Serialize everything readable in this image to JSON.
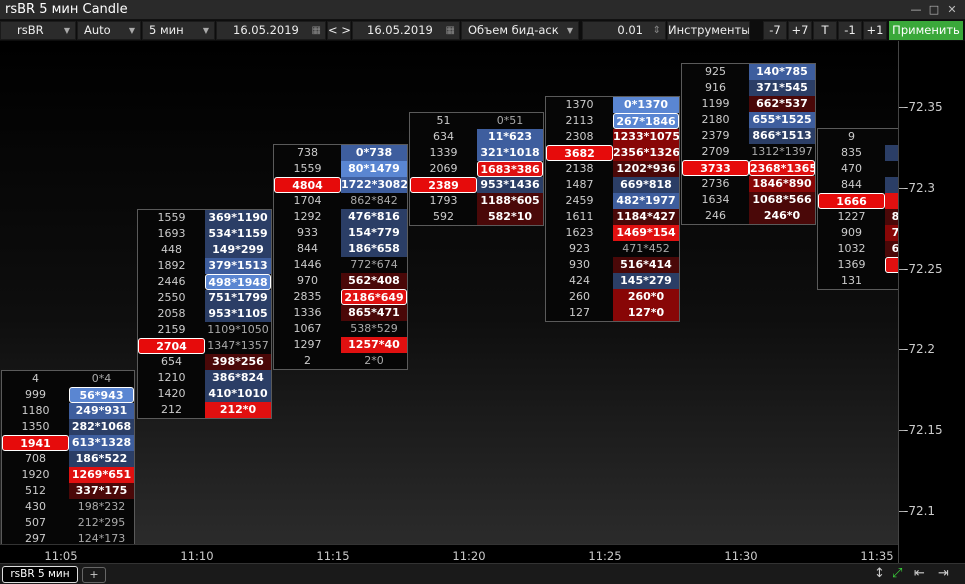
{
  "window": {
    "title": "rsBR 5 мин Candle"
  },
  "toolbar": {
    "symbol": "rsBR",
    "scale": "Auto",
    "timeframe": "5 мин",
    "date_from": "16.05.2019",
    "nav": "< >",
    "date_to": "16.05.2019",
    "mode": "Объем бид-аск",
    "step": "0.01",
    "instruments": "Инструменты",
    "btn_m7": "-7",
    "btn_p7": "+7",
    "btn_t": "T",
    "btn_m1": "-1",
    "btn_p1": "+1",
    "apply": "Применить"
  },
  "price_axis": [
    "-72.35",
    "-72.3",
    "-72.25",
    "-72.2",
    "-72.15",
    "-72.1"
  ],
  "time_axis": [
    "11:05",
    "11:10",
    "11:15",
    "11:20",
    "11:25",
    "11:30",
    "11:35"
  ],
  "tabs": {
    "main": "rsBR 5 мин",
    "add": "+"
  },
  "colors": {
    "bid_strong": "#8b0000",
    "ask_strong": "#3a63b0",
    "poc": "#e60b0b",
    "apply": "#3aa83a"
  },
  "candles": [
    {
      "time": "11:05",
      "rows": [
        {
          "v": "4",
          "ba": "0*4",
          "c": "n"
        },
        {
          "v": "999",
          "ba": "56*943",
          "c": "b3",
          "hl": true
        },
        {
          "v": "1180",
          "ba": "249*931",
          "c": "b2"
        },
        {
          "v": "1350",
          "ba": "282*1068",
          "c": "b1"
        },
        {
          "v": "1941",
          "ba": "613*1328",
          "c": "b2",
          "poc": true
        },
        {
          "v": "708",
          "ba": "186*522",
          "c": "b1"
        },
        {
          "v": "1920",
          "ba": "1269*651",
          "c": "r3"
        },
        {
          "v": "512",
          "ba": "337*175",
          "c": "r1"
        },
        {
          "v": "430",
          "ba": "198*232",
          "c": "n"
        },
        {
          "v": "507",
          "ba": "212*295",
          "c": "n"
        },
        {
          "v": "297",
          "ba": "124*173",
          "c": "n"
        }
      ]
    },
    {
      "time": "11:10",
      "rows": [
        {
          "v": "1559",
          "ba": "369*1190",
          "c": "b1"
        },
        {
          "v": "1693",
          "ba": "534*1159",
          "c": "b1"
        },
        {
          "v": "448",
          "ba": "149*299",
          "c": "b1"
        },
        {
          "v": "1892",
          "ba": "379*1513",
          "c": "b2"
        },
        {
          "v": "2446",
          "ba": "498*1948",
          "c": "b3",
          "hl": true
        },
        {
          "v": "2550",
          "ba": "751*1799",
          "c": "b1"
        },
        {
          "v": "2058",
          "ba": "953*1105",
          "c": "b1"
        },
        {
          "v": "2159",
          "ba": "1109*1050",
          "c": "n"
        },
        {
          "v": "2704",
          "ba": "1347*1357",
          "c": "n",
          "poc": true
        },
        {
          "v": "654",
          "ba": "398*256",
          "c": "r1"
        },
        {
          "v": "1210",
          "ba": "386*824",
          "c": "b1"
        },
        {
          "v": "1420",
          "ba": "410*1010",
          "c": "b1"
        },
        {
          "v": "212",
          "ba": "212*0",
          "c": "r3"
        }
      ]
    },
    {
      "time": "11:15",
      "rows": [
        {
          "v": "738",
          "ba": "0*738",
          "c": "b2"
        },
        {
          "v": "1559",
          "ba": "80*1479",
          "c": "b3"
        },
        {
          "v": "4804",
          "ba": "1722*3082",
          "c": "b2",
          "poc": true
        },
        {
          "v": "1704",
          "ba": "862*842",
          "c": "n"
        },
        {
          "v": "1292",
          "ba": "476*816",
          "c": "b1"
        },
        {
          "v": "933",
          "ba": "154*779",
          "c": "b1"
        },
        {
          "v": "844",
          "ba": "186*658",
          "c": "b1"
        },
        {
          "v": "1446",
          "ba": "772*674",
          "c": "n"
        },
        {
          "v": "970",
          "ba": "562*408",
          "c": "r1"
        },
        {
          "v": "2835",
          "ba": "2186*649",
          "c": "r3",
          "hl": true
        },
        {
          "v": "1336",
          "ba": "865*471",
          "c": "r1"
        },
        {
          "v": "1067",
          "ba": "538*529",
          "c": "n"
        },
        {
          "v": "1297",
          "ba": "1257*40",
          "c": "r3"
        },
        {
          "v": "2",
          "ba": "2*0",
          "c": "n"
        }
      ]
    },
    {
      "time": "11:20",
      "rows": [
        {
          "v": "51",
          "ba": "0*51",
          "c": "n"
        },
        {
          "v": "634",
          "ba": "11*623",
          "c": "b2"
        },
        {
          "v": "1339",
          "ba": "321*1018",
          "c": "b2"
        },
        {
          "v": "2069",
          "ba": "1683*386",
          "c": "r3",
          "hl": true
        },
        {
          "v": "2389",
          "ba": "953*1436",
          "c": "b1",
          "poc": true
        },
        {
          "v": "1793",
          "ba": "1188*605",
          "c": "r1"
        },
        {
          "v": "592",
          "ba": "582*10",
          "c": "r1"
        }
      ]
    },
    {
      "time": "11:25",
      "rows": [
        {
          "v": "1370",
          "ba": "0*1370",
          "c": "b3"
        },
        {
          "v": "2113",
          "ba": "267*1846",
          "c": "b3",
          "hl": true
        },
        {
          "v": "2308",
          "ba": "1233*1075",
          "c": "r2"
        },
        {
          "v": "3682",
          "ba": "2356*1326",
          "c": "r2",
          "poc": true
        },
        {
          "v": "2138",
          "ba": "1202*936",
          "c": "r1"
        },
        {
          "v": "1487",
          "ba": "669*818",
          "c": "b1"
        },
        {
          "v": "2459",
          "ba": "482*1977",
          "c": "b2"
        },
        {
          "v": "1611",
          "ba": "1184*427",
          "c": "r1"
        },
        {
          "v": "1623",
          "ba": "1469*154",
          "c": "r3"
        },
        {
          "v": "923",
          "ba": "471*452",
          "c": "n"
        },
        {
          "v": "930",
          "ba": "516*414",
          "c": "r1"
        },
        {
          "v": "424",
          "ba": "145*279",
          "c": "b1"
        },
        {
          "v": "260",
          "ba": "260*0",
          "c": "r2"
        },
        {
          "v": "127",
          "ba": "127*0",
          "c": "r2"
        }
      ]
    },
    {
      "time": "11:30",
      "rows": [
        {
          "v": "925",
          "ba": "140*785",
          "c": "b2"
        },
        {
          "v": "916",
          "ba": "371*545",
          "c": "b1"
        },
        {
          "v": "1199",
          "ba": "662*537",
          "c": "r1"
        },
        {
          "v": "2180",
          "ba": "655*1525",
          "c": "b2"
        },
        {
          "v": "2379",
          "ba": "866*1513",
          "c": "b1"
        },
        {
          "v": "2709",
          "ba": "1312*1397",
          "c": "n"
        },
        {
          "v": "3733",
          "ba": "2368*1365",
          "c": "r3",
          "poc": true,
          "hl": true
        },
        {
          "v": "2736",
          "ba": "1846*890",
          "c": "r2"
        },
        {
          "v": "1634",
          "ba": "1068*566",
          "c": "r1"
        },
        {
          "v": "246",
          "ba": "246*0",
          "c": "r1"
        }
      ]
    },
    {
      "time": "11:35",
      "rows": [
        {
          "v": "9",
          "ba": "",
          "c": "n"
        },
        {
          "v": "835",
          "ba": "",
          "c": "b1"
        },
        {
          "v": "470",
          "ba": "",
          "c": "n"
        },
        {
          "v": "844",
          "ba": "",
          "c": "b1"
        },
        {
          "v": "1666",
          "ba": "",
          "c": "r3",
          "poc": true
        },
        {
          "v": "1227",
          "ba": "8",
          "c": "r1"
        },
        {
          "v": "909",
          "ba": "7",
          "c": "r2"
        },
        {
          "v": "1032",
          "ba": "6",
          "c": "r1"
        },
        {
          "v": "1369",
          "ba": "",
          "c": "r3",
          "hl": true
        },
        {
          "v": "131",
          "ba": "",
          "c": "n"
        }
      ]
    }
  ]
}
